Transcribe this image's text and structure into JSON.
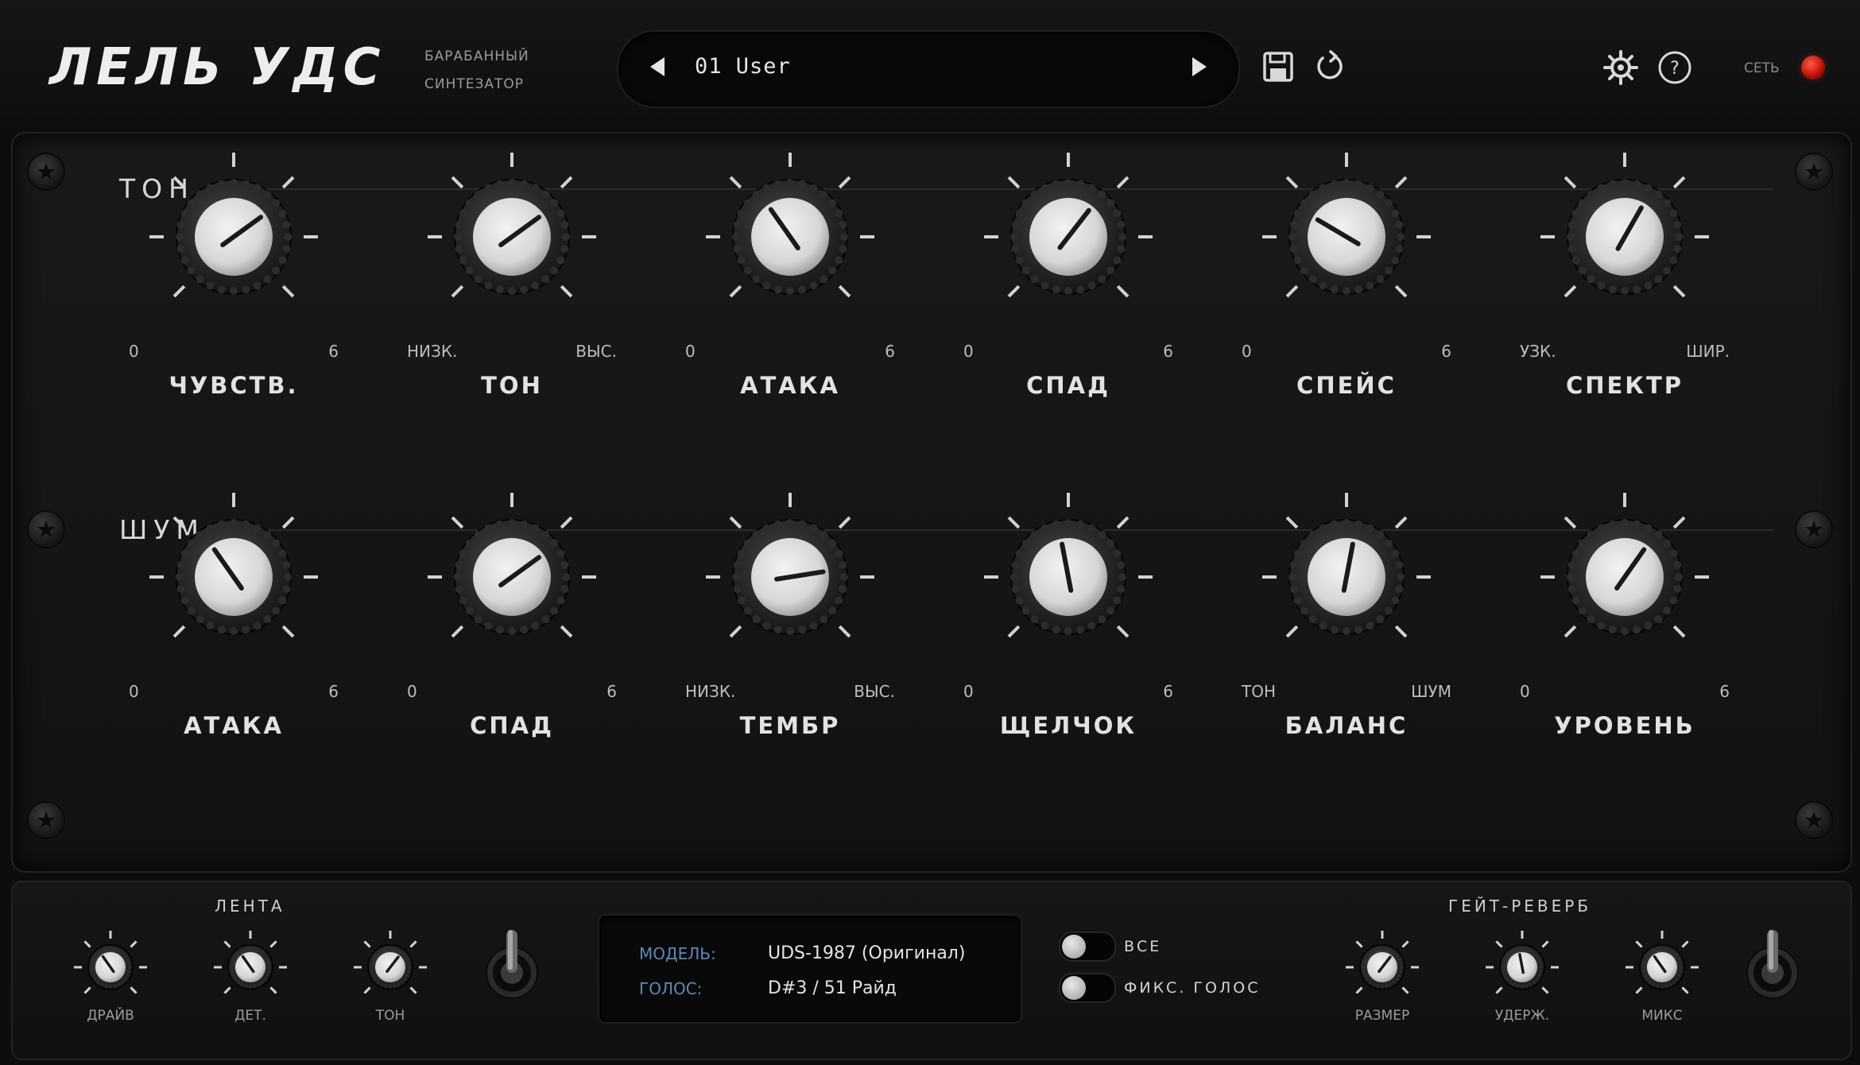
{
  "header": {
    "brand": "ЛЕЛЬ УДС",
    "subtitle_line1": "БАРАБАННЫЙ",
    "subtitle_line2": "СИНТЕЗАТОР",
    "preset_name": "01 User",
    "net_label": "СЕТЬ",
    "icons": [
      "save-icon",
      "reset-icon",
      "gear-icon",
      "help-icon"
    ]
  },
  "tone_section": {
    "title": "ТОН",
    "knobs": [
      {
        "label": "ЧУВСТВ.",
        "min": "0",
        "max": "6",
        "value": 0.7
      },
      {
        "label": "ТОН",
        "min": "НИЗК.",
        "max": "ВЫС.",
        "value": 0.7
      },
      {
        "label": "АТАКА",
        "min": "0",
        "max": "6",
        "value": 0.37
      },
      {
        "label": "СПАД",
        "min": "0",
        "max": "6",
        "value": 0.64
      },
      {
        "label": "СПЕЙС",
        "min": "0",
        "max": "6",
        "value": 0.28
      },
      {
        "label": "СПЕКТР",
        "min": "УЗК.",
        "max": "ШИР.",
        "value": 0.61
      }
    ]
  },
  "noise_section": {
    "title": "ШУМ",
    "knobs": [
      {
        "label": "АТАКА",
        "min": "0",
        "max": "6",
        "value": 0.37
      },
      {
        "label": "СПАД",
        "min": "0",
        "max": "6",
        "value": 0.7
      },
      {
        "label": "ТЕМБР",
        "min": "НИЗК.",
        "max": "ВЫС.",
        "value": 0.8
      },
      {
        "label": "ЩЕЛЧОК",
        "min": "0",
        "max": "6",
        "value": 0.46
      },
      {
        "label": "БАЛАНС",
        "min": "ТОН",
        "max": "ШУМ",
        "value": 0.54
      },
      {
        "label": "УРОВЕНЬ",
        "min": "0",
        "max": "6",
        "value": 0.63
      }
    ]
  },
  "tape": {
    "title": "ЛЕНТА",
    "knobs": [
      {
        "label": "ДРАЙВ",
        "value": 0.37
      },
      {
        "label": "ДЕТ.",
        "value": 0.37
      },
      {
        "label": "ТОН",
        "value": 0.64
      }
    ]
  },
  "info": {
    "model_key": "МОДЕЛЬ:",
    "model_value": "UDS-1987 (Оригинал)",
    "voice_key": "ГОЛОС:",
    "voice_value": "D#3 / 51 Райд"
  },
  "toggles": {
    "all_label": "ВСЕ",
    "fixed_voice_label": "ФИКС. ГОЛОС"
  },
  "gate_reverb": {
    "title": "ГЕЙТ-РЕВЕРБ",
    "knobs": [
      {
        "label": "РАЗМЕР",
        "value": 0.64
      },
      {
        "label": "УДЕРЖ.",
        "value": 0.46
      },
      {
        "label": "МИКС",
        "value": 0.37
      }
    ]
  }
}
